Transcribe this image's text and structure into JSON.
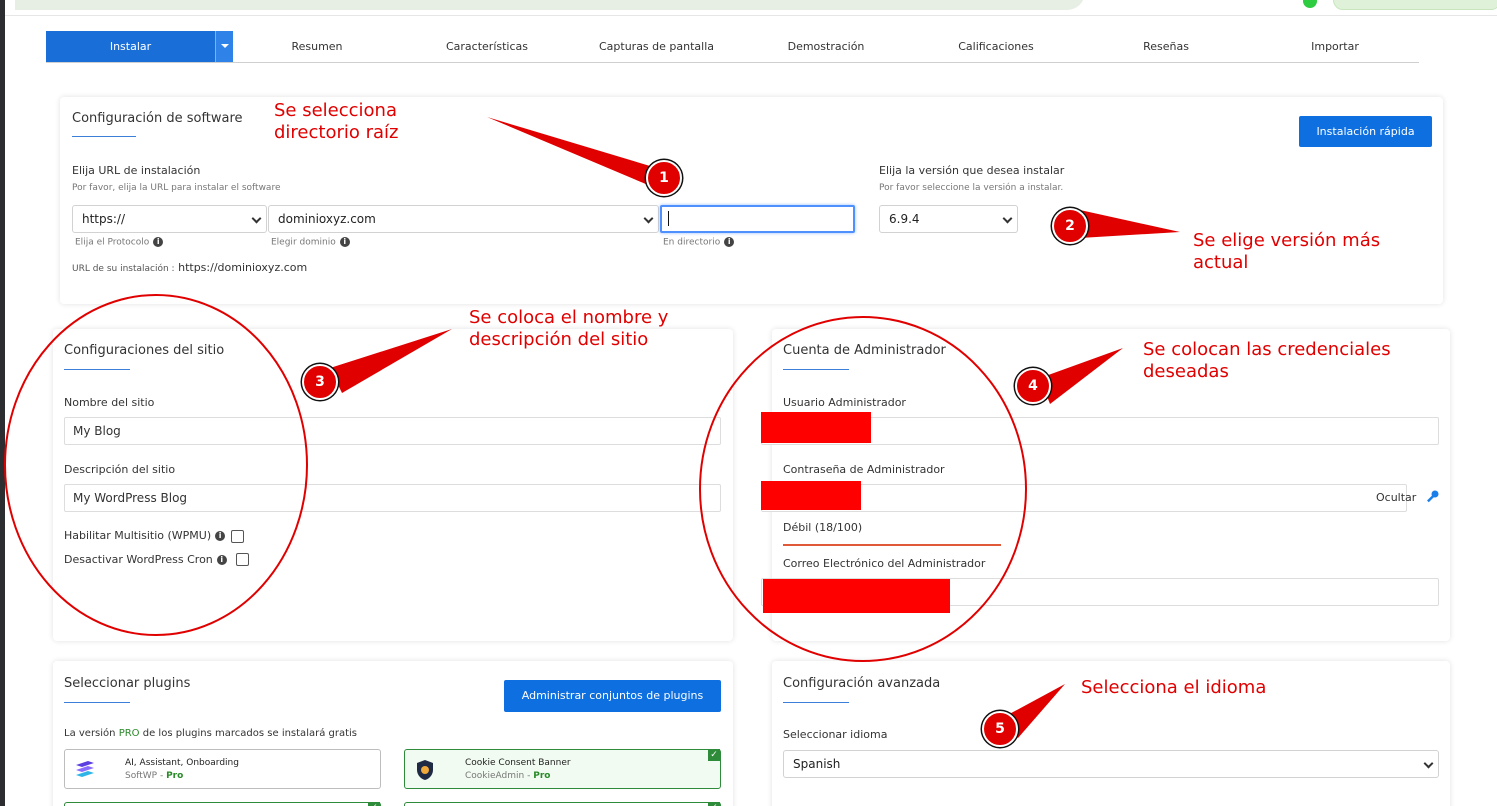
{
  "tabs": {
    "items": [
      "Instalar",
      "Resumen",
      "Características",
      "Capturas de pantalla",
      "Demostración",
      "Calificaciones",
      "Reseñas",
      "Importar"
    ]
  },
  "software": {
    "title": "Configuración de software",
    "quick_install": "Instalación rápida",
    "url_label": "Elija URL de instalación",
    "url_hint": "Por favor, elija la URL para instalar el software",
    "protocol": "https://",
    "domain": "dominioxyz.com",
    "directory": "",
    "protocol_hint": "Elija el Protocolo",
    "domain_hint": "Elegir dominio",
    "directory_hint": "En directorio",
    "url_prefix": "URL de su instalación :",
    "url_value": "https://dominioxyz.com",
    "version_label": "Elija la versión que desea instalar",
    "version_hint": "Por favor seleccione la versión a instalar.",
    "version": "6.9.4"
  },
  "site": {
    "title": "Configuraciones del sitio",
    "name_label": "Nombre del sitio",
    "name_value": "My Blog",
    "desc_label": "Descripción del sitio",
    "desc_value": "My WordPress Blog",
    "multisite": "Habilitar Multisitio (WPMU)",
    "cron": "Desactivar WordPress Cron"
  },
  "admin": {
    "title": "Cuenta de Administrador",
    "user_label": "Usuario Administrador",
    "pass_label": "Contraseña de Administrador",
    "hide": "Ocultar",
    "strength": "Débil (18/100)",
    "email_label": "Correo Electrónico del Administrador"
  },
  "plugins": {
    "title": "Seleccionar plugins",
    "manage": "Administrar conjuntos de plugins",
    "note_pre": "La versión",
    "note_pro": "PRO",
    "note_post": "de los plugins marcados se instalará gratis",
    "items": [
      {
        "name": "AI, Assistant, Onboarding",
        "by": "SoftWP",
        "tag": "Pro"
      },
      {
        "name": "Cookie Consent Banner",
        "by": "CookieAdmin",
        "tag": "Pro"
      }
    ]
  },
  "advanced": {
    "title": "Configuración avanzada",
    "lang_label": "Seleccionar idioma",
    "lang_value": "Spanish"
  },
  "annotations": {
    "a1": "Se selecciona directorio raíz",
    "a2": "Se elige versión más actual",
    "a3": "Se coloca el nombre y descripción del sitio",
    "a4": "Se colocan las credenciales deseadas",
    "a5": "Selecciona el idioma",
    "b1": "1",
    "b2": "2",
    "b3": "3",
    "b4": "4",
    "b5": "5"
  },
  "colors": {
    "accent": "#0d6fe0",
    "annotation": "#e00000"
  }
}
